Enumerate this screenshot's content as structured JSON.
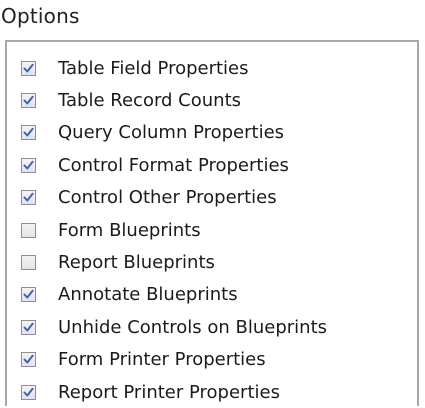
{
  "title": "Options",
  "colors": {
    "checkmark": "#3a64b5",
    "panel_border": "#a9a9a9"
  },
  "options": [
    {
      "label": "Table Field Properties",
      "checked": true
    },
    {
      "label": "Table Record Counts",
      "checked": true
    },
    {
      "label": "Query Column Properties",
      "checked": true
    },
    {
      "label": "Control Format Properties",
      "checked": true
    },
    {
      "label": "Control Other Properties",
      "checked": true
    },
    {
      "label": "Form Blueprints",
      "checked": false
    },
    {
      "label": "Report Blueprints",
      "checked": false
    },
    {
      "label": "Annotate Blueprints",
      "checked": true
    },
    {
      "label": "Unhide Controls on Blueprints",
      "checked": true
    },
    {
      "label": "Form Printer Properties",
      "checked": true
    },
    {
      "label": "Report Printer Properties",
      "checked": true
    }
  ]
}
